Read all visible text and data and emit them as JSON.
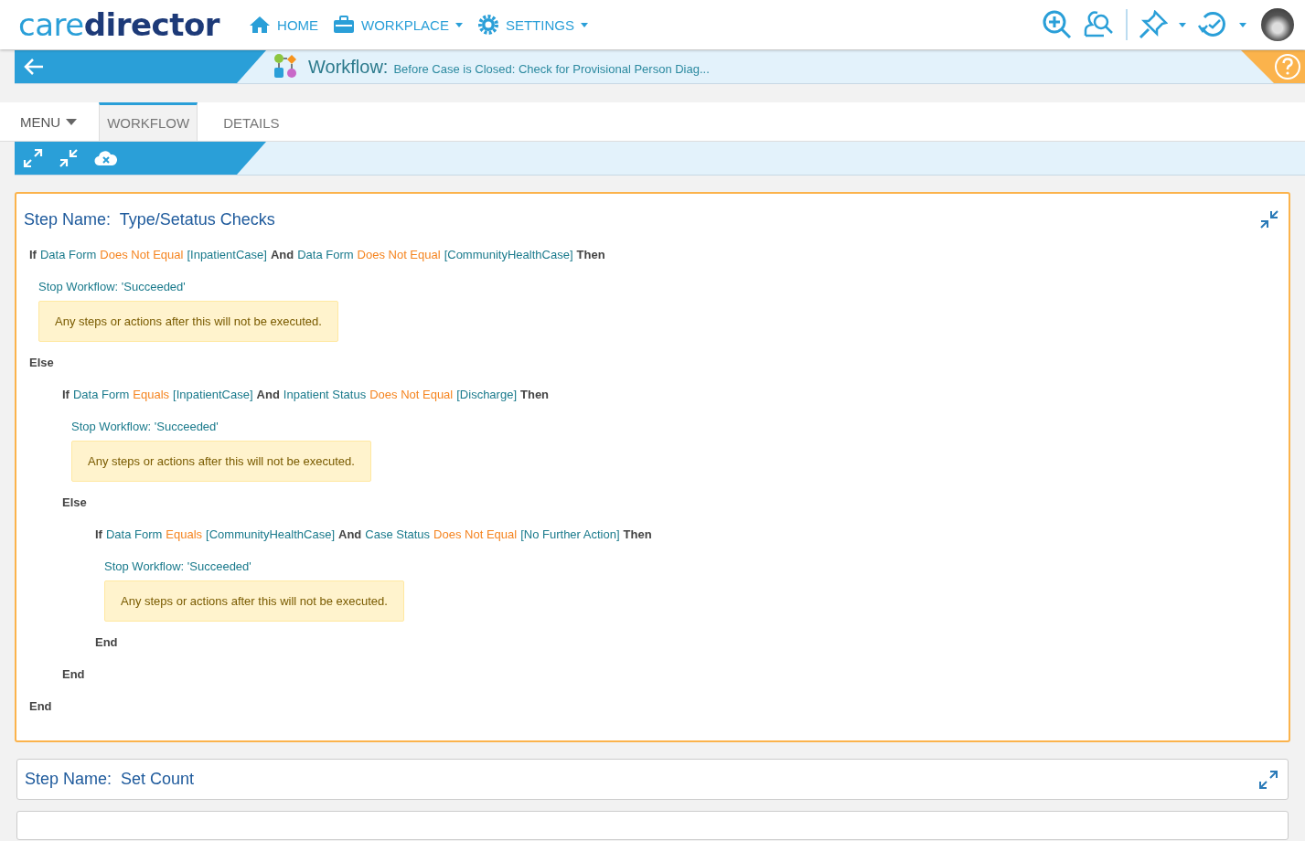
{
  "header": {
    "logo": {
      "light": "care",
      "dark": "director"
    },
    "nav": [
      {
        "kind": "home",
        "label": "HOME",
        "dropdown": false
      },
      {
        "kind": "briefcase",
        "label": "WORKPLACE",
        "dropdown": true
      },
      {
        "kind": "gear",
        "label": "SETTINGS",
        "dropdown": true
      }
    ]
  },
  "title_bar": {
    "title": "Workflow:",
    "subtitle": "Before Case is Closed: Check for Provisional Person Diag..."
  },
  "tabs": [
    {
      "label": "MENU",
      "kind": "menu",
      "selected": false
    },
    {
      "label": "WORKFLOW",
      "kind": "tab",
      "selected": true
    },
    {
      "label": "DETAILS",
      "kind": "tab",
      "selected": false
    }
  ],
  "steps": [
    {
      "label": "Step Name:",
      "name": "Type/Setatus Checks",
      "expanded": true,
      "body": [
        {
          "kind": "if",
          "segments": [
            {
              "kind": "keyword",
              "text": "If"
            },
            {
              "kind": "field",
              "text": "Data Form"
            },
            {
              "kind": "operator",
              "text": "Does Not Equal"
            },
            {
              "kind": "value",
              "text": "[InpatientCase]"
            },
            {
              "kind": "keyword",
              "text": "And"
            },
            {
              "kind": "field",
              "text": "Data Form"
            },
            {
              "kind": "operator",
              "text": "Does Not Equal"
            },
            {
              "kind": "value",
              "text": "[CommunityHealthCase]"
            },
            {
              "kind": "keyword",
              "text": "Then"
            }
          ],
          "children": [
            {
              "kind": "stop",
              "text": "Stop Workflow: 'Succeeded'",
              "note": "Any steps or actions after this will not be executed."
            }
          ]
        },
        {
          "kind": "else",
          "label": "Else",
          "children": [
            {
              "kind": "if",
              "segments": [
                {
                  "kind": "keyword",
                  "text": "If"
                },
                {
                  "kind": "field",
                  "text": "Data Form"
                },
                {
                  "kind": "operator",
                  "text": "Equals"
                },
                {
                  "kind": "value",
                  "text": "[InpatientCase]"
                },
                {
                  "kind": "keyword",
                  "text": "And"
                },
                {
                  "kind": "field",
                  "text": "Inpatient Status"
                },
                {
                  "kind": "operator",
                  "text": "Does Not Equal"
                },
                {
                  "kind": "value",
                  "text": "[Discharge]"
                },
                {
                  "kind": "keyword",
                  "text": "Then"
                }
              ],
              "children": [
                {
                  "kind": "stop",
                  "text": "Stop Workflow: 'Succeeded'",
                  "note": "Any steps or actions after this will not be executed."
                }
              ]
            },
            {
              "kind": "else",
              "label": "Else",
              "children": [
                {
                  "kind": "if",
                  "segments": [
                    {
                      "kind": "keyword",
                      "text": "If"
                    },
                    {
                      "kind": "field",
                      "text": "Data Form"
                    },
                    {
                      "kind": "operator",
                      "text": "Equals"
                    },
                    {
                      "kind": "value",
                      "text": "[CommunityHealthCase]"
                    },
                    {
                      "kind": "keyword",
                      "text": "And"
                    },
                    {
                      "kind": "field",
                      "text": "Case Status"
                    },
                    {
                      "kind": "operator",
                      "text": "Does Not Equal"
                    },
                    {
                      "kind": "value",
                      "text": "[No Further Action]"
                    },
                    {
                      "kind": "keyword",
                      "text": "Then"
                    }
                  ],
                  "children": [
                    {
                      "kind": "stop",
                      "text": "Stop Workflow: 'Succeeded'",
                      "note": "Any steps or actions after this will not be executed."
                    }
                  ]
                },
                {
                  "kind": "end",
                  "label": "End"
                }
              ]
            },
            {
              "kind": "end",
              "label": "End"
            }
          ]
        },
        {
          "kind": "end",
          "label": "End"
        }
      ]
    },
    {
      "label": "Step Name:",
      "name": "Set Count",
      "expanded": false
    }
  ]
}
